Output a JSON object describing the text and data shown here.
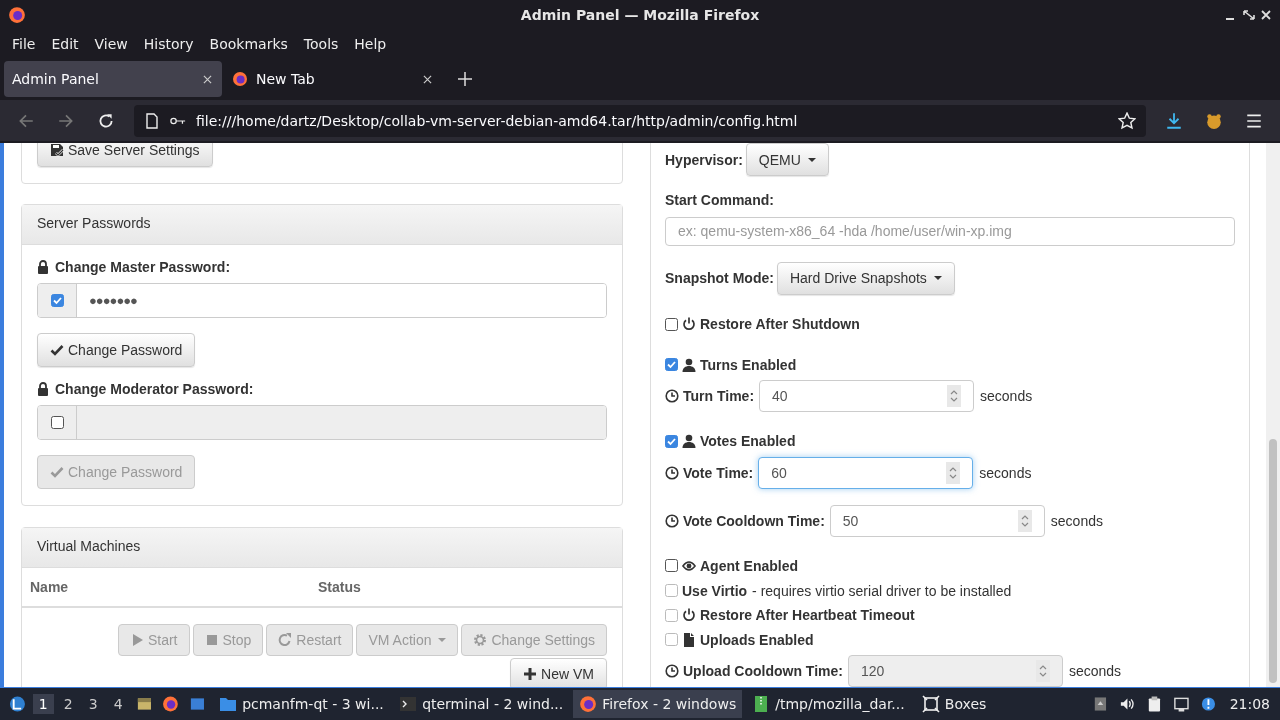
{
  "window": {
    "title": "Admin Panel — Mozilla Firefox"
  },
  "menu": [
    "File",
    "Edit",
    "View",
    "History",
    "Bookmarks",
    "Tools",
    "Help"
  ],
  "tabs": [
    {
      "label": "Admin Panel",
      "selected": true,
      "has_icon": false
    },
    {
      "label": "New Tab",
      "selected": false,
      "has_icon": true
    }
  ],
  "address": {
    "url": "file:///home/dartz/Desktop/collab-vm-server-debian-amd64.tar/http/admin/config.html"
  },
  "left": {
    "save_button": "Save Server Settings",
    "passwords": {
      "title": "Server Passwords",
      "fields": [
        {
          "label": "Change Master Password:",
          "checked": true,
          "value": "●●●●●●●",
          "button": "Change Password"
        },
        {
          "label": "Change Moderator Password:",
          "checked": false,
          "button": "Change Password"
        }
      ]
    },
    "vms": {
      "title": "Virtual Machines",
      "columns": [
        "Name",
        "Status"
      ],
      "actions": [
        {
          "label": "Start",
          "dropdown": false,
          "disabled": true
        },
        {
          "label": "Stop",
          "dropdown": false,
          "disabled": true
        },
        {
          "label": "Restart",
          "dropdown": false,
          "disabled": true
        },
        {
          "label": "VM Action",
          "dropdown": true,
          "disabled": true
        },
        {
          "label": "Change Settings",
          "dropdown": false,
          "disabled": true
        }
      ],
      "new_vm": "New VM"
    }
  },
  "right": {
    "hypervisor": {
      "label": "Hypervisor:",
      "value": "QEMU"
    },
    "start_command": {
      "label": "Start Command:",
      "placeholder": "ex: qemu-system-x86_64 -hda /home/user/win-xp.img"
    },
    "snapshot_mode": {
      "label": "Snapshot Mode:",
      "value": "Hard Drive Snapshots"
    },
    "options": [
      {
        "kind": "power",
        "label": "Restore After Shutdown",
        "checked": false,
        "disabled": false
      },
      {
        "kind": "user",
        "label": "Turns Enabled",
        "checked": true,
        "disabled": false
      },
      {
        "kind": "number",
        "label": "Turn Time:",
        "value": "40",
        "unit": "seconds",
        "focused": false,
        "disabled": false
      },
      {
        "kind": "user",
        "label": "Votes Enabled",
        "checked": true,
        "disabled": false
      },
      {
        "kind": "number",
        "label": "Vote Time:",
        "value": "60",
        "unit": "seconds",
        "focused": true,
        "disabled": false
      },
      {
        "kind": "number",
        "label": "Vote Cooldown Time:",
        "value": "50",
        "unit": "seconds",
        "focused": false,
        "disabled": false
      },
      {
        "kind": "eye",
        "label": "Agent Enabled",
        "checked": false,
        "disabled": false
      },
      {
        "kind": "plain",
        "label": "Use Virtio",
        "note": "- requires virtio serial driver to be installed",
        "checked": false,
        "disabled": true
      },
      {
        "kind": "power",
        "label": "Restore After Heartbeat Timeout",
        "checked": false,
        "disabled": true
      },
      {
        "kind": "file",
        "label": "Uploads Enabled",
        "checked": false,
        "disabled": true
      },
      {
        "kind": "number",
        "label": "Upload Cooldown Time:",
        "value": "120",
        "unit": "seconds",
        "focused": false,
        "disabled": true
      }
    ]
  },
  "taskbar": {
    "workspaces": [
      {
        "label": "1",
        "selected": true
      },
      {
        "label": "2",
        "selected": false
      },
      {
        "label": "3",
        "selected": false
      },
      {
        "label": "4",
        "selected": false
      }
    ],
    "tasks": [
      {
        "label": "pcmanfm-qt - 3 wi...",
        "selected": false
      },
      {
        "label": "qterminal - 2 wind...",
        "selected": false
      },
      {
        "label": "Firefox - 2 windows",
        "selected": true
      },
      {
        "label": "/tmp/mozilla_dar...",
        "selected": false
      },
      {
        "label": "Boxes",
        "selected": false
      }
    ],
    "clock": "21:08"
  }
}
